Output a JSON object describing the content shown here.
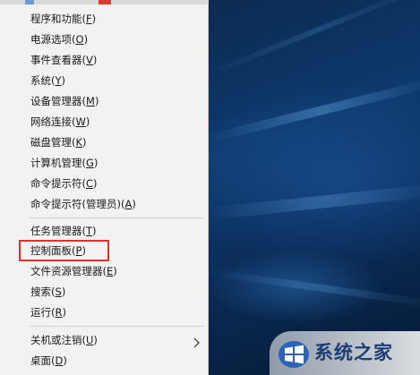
{
  "menu": {
    "items": [
      {
        "label": "程序和功能(",
        "key": "F",
        "end": ")"
      },
      {
        "label": "电源选项(",
        "key": "O",
        "end": ")"
      },
      {
        "label": "事件查看器(",
        "key": "V",
        "end": ")"
      },
      {
        "label": "系统(",
        "key": "Y",
        "end": ")"
      },
      {
        "label": "设备管理器(",
        "key": "M",
        "end": ")"
      },
      {
        "label": "网络连接(",
        "key": "W",
        "end": ")"
      },
      {
        "label": "磁盘管理(",
        "key": "K",
        "end": ")"
      },
      {
        "label": "计算机管理(",
        "key": "G",
        "end": ")"
      },
      {
        "label": "命令提示符(",
        "key": "C",
        "end": ")"
      },
      {
        "label": "命令提示符(管理员)(",
        "key": "A",
        "end": ")"
      },
      {
        "label": "任务管理器(",
        "key": "T",
        "end": ")"
      },
      {
        "label": "控制面板(",
        "key": "P",
        "end": ")"
      },
      {
        "label": "文件资源管理器(",
        "key": "E",
        "end": ")"
      },
      {
        "label": "搜索(",
        "key": "S",
        "end": ")"
      },
      {
        "label": "运行(",
        "key": "R",
        "end": ")"
      },
      {
        "label": "关机或注销(",
        "key": "U",
        "end": ")"
      },
      {
        "label": "桌面(",
        "key": "D",
        "end": ")"
      }
    ],
    "highlighted_item": "控制面板(P)",
    "submenu_indicator_icon": "chevron-right-icon"
  },
  "watermark": {
    "text": "系统之家",
    "logo_icon": "windows-logo-icon"
  },
  "colors": {
    "menu_bg": "#f2f2f2",
    "highlight_border": "#e0302e",
    "desktop_bg": "#0b2b52"
  }
}
